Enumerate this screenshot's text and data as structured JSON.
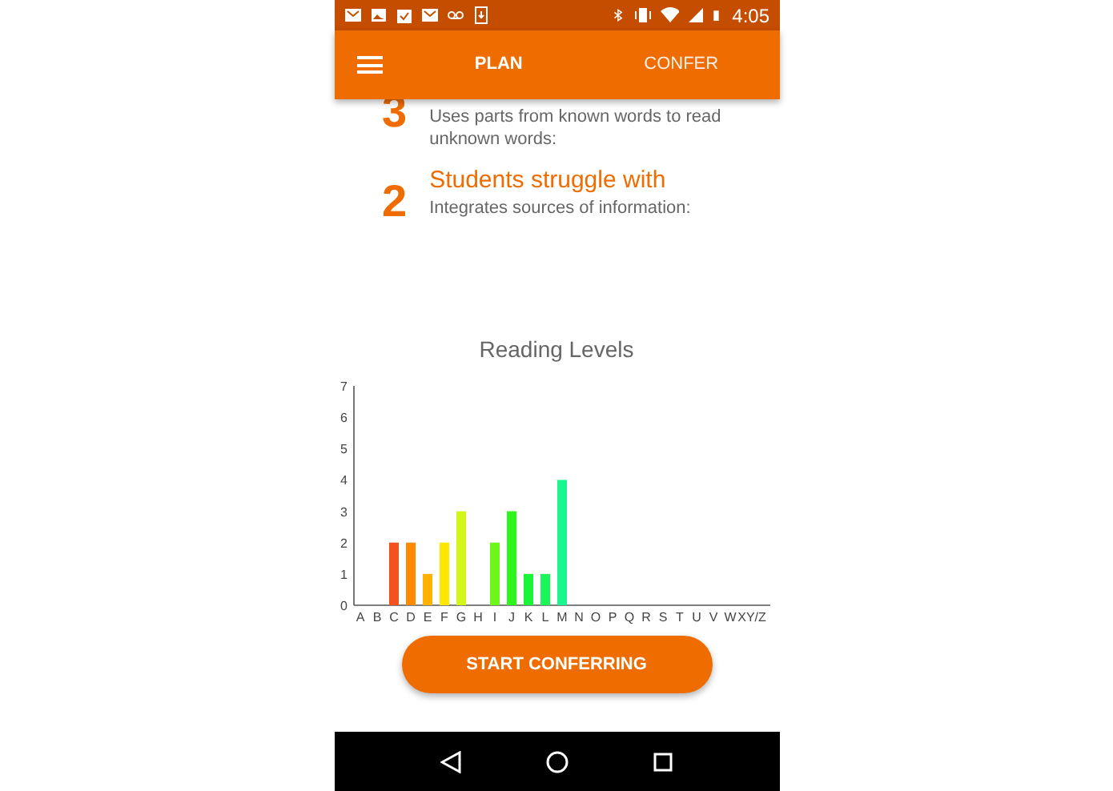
{
  "status_bar": {
    "time": "4:05"
  },
  "app_bar": {
    "tabs": [
      {
        "label": "PLAN",
        "selected": true
      },
      {
        "label": "CONFER",
        "selected": false
      }
    ]
  },
  "struggles": [
    {
      "number": "3",
      "description": "Uses parts from known words to read unknown words:"
    },
    {
      "number": "2",
      "title": "Students struggle with",
      "description": "Integrates sources of information:"
    }
  ],
  "chart": {
    "chart_data": {
      "type": "bar",
      "title": "Reading Levels",
      "categories": [
        "A",
        "B",
        "C",
        "D",
        "E",
        "F",
        "G",
        "H",
        "I",
        "J",
        "K",
        "L",
        "M",
        "N",
        "O",
        "P",
        "Q",
        "R",
        "S",
        "T",
        "U",
        "V",
        "W",
        "XY/Z"
      ],
      "values": [
        0,
        0,
        2,
        2,
        1,
        2,
        3,
        0,
        2,
        3,
        1,
        1,
        4,
        0,
        0,
        0,
        0,
        0,
        0,
        0,
        0,
        0,
        0,
        0
      ],
      "colors": [
        null,
        null,
        "#f4511e",
        "#ff8a00",
        "#ffb300",
        "#ffe600",
        "#d4f51a",
        null,
        "#6ef51a",
        "#2ef51a",
        "#1af53a",
        "#1af55a",
        "#1af590",
        null,
        null,
        null,
        null,
        null,
        null,
        null,
        null,
        null,
        null,
        null
      ],
      "ylim": [
        0,
        7
      ],
      "yticks": [
        0,
        1,
        2,
        3,
        4,
        5,
        6,
        7
      ]
    }
  },
  "button": {
    "label": "START CONFERRING"
  }
}
